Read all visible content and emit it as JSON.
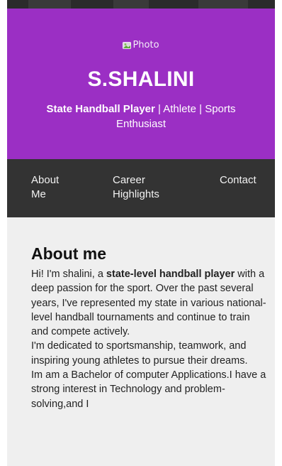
{
  "hero": {
    "photo_alt": "Photo",
    "name": "S.SHALINI",
    "tagline_bold": "State Handball Player",
    "tagline_rest": " | Athlete | Sports Enthusiast"
  },
  "nav": {
    "about_label": "About Me",
    "career_label": "Career Highlights",
    "contact_label": "Contact"
  },
  "about": {
    "title": "About me",
    "p1_a": "Hi! I'm shalini, a ",
    "p1_bold": "state-level handball player",
    "p1_b": " with a deep passion for the sport. Over the past several years, I've represented my state in various national-level handball tournaments and continue to train and compete actively.",
    "p2": "I'm dedicated to sportsmanship, teamwork, and inspiring young athletes to pursue their dreams.",
    "p3": "Im am a Bachelor of computer Applications.I have a strong interest in Technology and problem-solving,and I"
  },
  "colors": {
    "hero_bg": "#9b2fc4",
    "nav_bg": "#333333",
    "content_bg": "#efefef"
  }
}
